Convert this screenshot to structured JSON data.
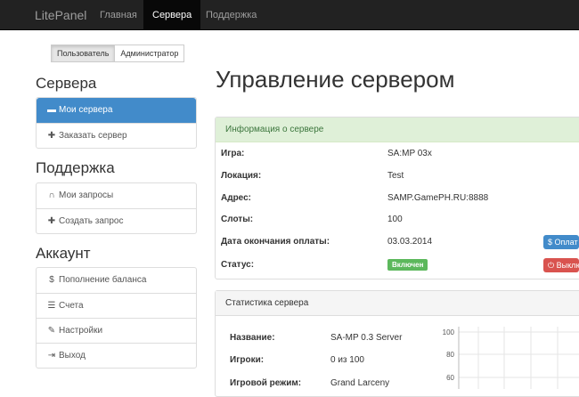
{
  "navbar": {
    "brand": "LitePanel",
    "items": [
      "Главная",
      "Сервера",
      "Поддержка"
    ]
  },
  "role_toggle": {
    "user": "Пользователь",
    "admin": "Администратор"
  },
  "sidebar": {
    "servers": {
      "heading": "Сервера",
      "items": [
        {
          "icon": "server-icon",
          "label": "Мои сервера"
        },
        {
          "icon": "plus-icon",
          "label": "Заказать сервер"
        }
      ]
    },
    "support": {
      "heading": "Поддержка",
      "items": [
        {
          "icon": "headphones-icon",
          "label": "Мои запросы"
        },
        {
          "icon": "plus-icon",
          "label": "Создать запрос"
        }
      ]
    },
    "account": {
      "heading": "Аккаунт",
      "items": [
        {
          "icon": "dollar-icon",
          "label": "Пополнение баланса"
        },
        {
          "icon": "list-icon",
          "label": "Счета"
        },
        {
          "icon": "wrench-icon",
          "label": "Настройки"
        },
        {
          "icon": "logout-icon",
          "label": "Выход"
        }
      ]
    }
  },
  "page": {
    "title": "Управление сервером"
  },
  "server_info": {
    "heading": "Информация о сервере",
    "game_label": "Игра:",
    "game": "SA:MP 03x",
    "location_label": "Локация:",
    "location": "Test",
    "address_label": "Адрес:",
    "address": "SAMP.GamePH.RU:8888",
    "slots_label": "Слоты:",
    "slots": "100",
    "paid_until_label": "Дата окончания оплаты:",
    "paid_until": "03.03.2014",
    "status_label": "Статус:",
    "status": "Включен",
    "pay_button": "$ Оплат",
    "power_button": "⏻ Выклю"
  },
  "stats": {
    "heading": "Статистика сервера",
    "name_label": "Название:",
    "name": "SA-MP 0.3 Server",
    "players_label": "Игроки:",
    "players": "0 из 100",
    "mode_label": "Игровой режим:",
    "mode": "Grand Larceny",
    "chart_ticks": [
      "100",
      "80",
      "60"
    ]
  },
  "colors": {
    "primary": "#428bca",
    "success": "#5cb85c",
    "danger": "#d9534f",
    "navbar": "#222222"
  }
}
